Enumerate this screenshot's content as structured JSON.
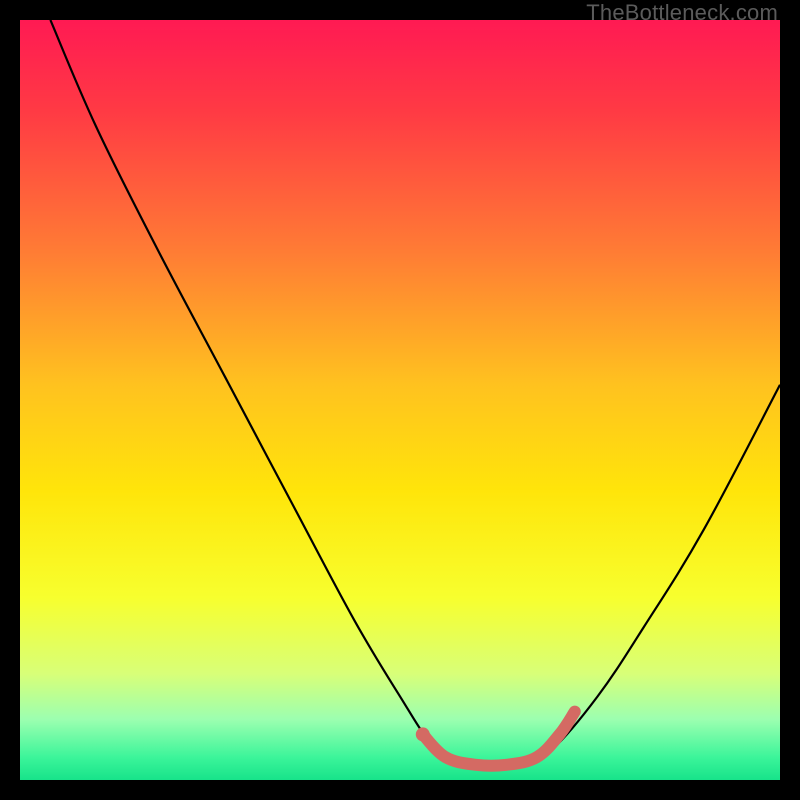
{
  "watermark": "TheBottleneck.com",
  "chart_data": {
    "type": "line",
    "title": "",
    "xlabel": "",
    "ylabel": "",
    "xlim": [
      0,
      100
    ],
    "ylim": [
      0,
      100
    ],
    "gradient_stops": [
      {
        "offset": 0,
        "color": "#ff1a53"
      },
      {
        "offset": 12,
        "color": "#ff3a44"
      },
      {
        "offset": 30,
        "color": "#ff7a35"
      },
      {
        "offset": 48,
        "color": "#ffc21f"
      },
      {
        "offset": 62,
        "color": "#ffe50a"
      },
      {
        "offset": 76,
        "color": "#f7ff2e"
      },
      {
        "offset": 86,
        "color": "#d8ff78"
      },
      {
        "offset": 92,
        "color": "#9cffb0"
      },
      {
        "offset": 97,
        "color": "#3cf59a"
      },
      {
        "offset": 100,
        "color": "#17e38a"
      }
    ],
    "series": [
      {
        "name": "bottleneck-curve",
        "color": "#000000",
        "width": 2.2,
        "points": [
          {
            "x": 4,
            "y": 100
          },
          {
            "x": 10,
            "y": 86
          },
          {
            "x": 18,
            "y": 70
          },
          {
            "x": 27,
            "y": 53
          },
          {
            "x": 36,
            "y": 36
          },
          {
            "x": 44,
            "y": 21
          },
          {
            "x": 50,
            "y": 11
          },
          {
            "x": 54,
            "y": 5
          },
          {
            "x": 58,
            "y": 2
          },
          {
            "x": 62,
            "y": 1.5
          },
          {
            "x": 66,
            "y": 2
          },
          {
            "x": 70,
            "y": 4
          },
          {
            "x": 76,
            "y": 11
          },
          {
            "x": 82,
            "y": 20
          },
          {
            "x": 90,
            "y": 33
          },
          {
            "x": 100,
            "y": 52
          }
        ]
      },
      {
        "name": "highlight-segment",
        "color": "#d46a63",
        "width": 12,
        "cap": "round",
        "points": [
          {
            "x": 53,
            "y": 6
          },
          {
            "x": 56,
            "y": 3
          },
          {
            "x": 60,
            "y": 2
          },
          {
            "x": 64,
            "y": 2
          },
          {
            "x": 68,
            "y": 3
          },
          {
            "x": 71,
            "y": 6
          },
          {
            "x": 73,
            "y": 9
          }
        ]
      }
    ],
    "highlight_dot": {
      "x": 53,
      "y": 6,
      "r": 7,
      "color": "#d46a63"
    }
  }
}
